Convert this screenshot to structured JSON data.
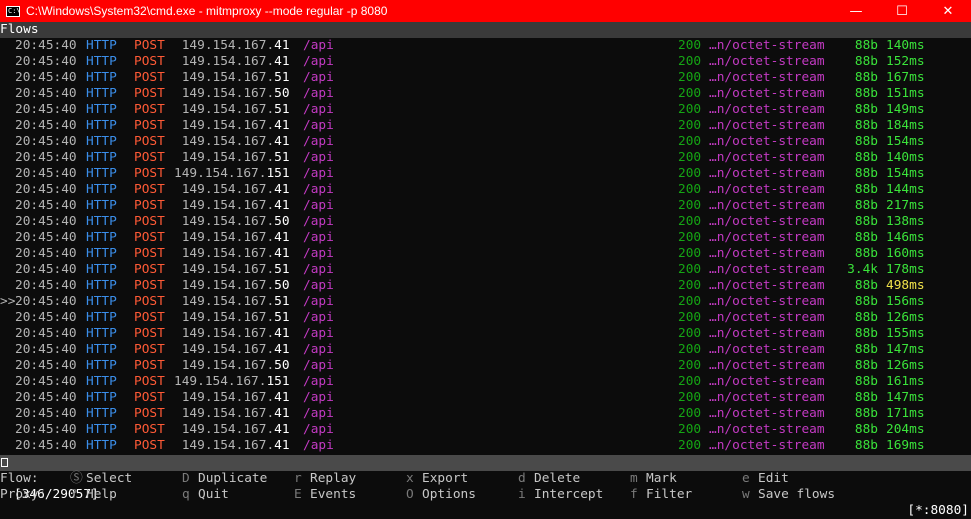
{
  "window": {
    "title": "C:\\Windows\\System32\\cmd.exe - mitmproxy  --mode regular -p 8080",
    "icon": "cmd-icon",
    "minimize_glyph": "—",
    "maximize_glyph": "☐",
    "close_glyph": "✕"
  },
  "header": {
    "label": "Flows"
  },
  "cursor_glyph": ">>",
  "flows": [
    {
      "time": "20:45:40",
      "scheme": "HTTP",
      "method": "POST",
      "host_prefix": " 149.154.167.",
      "host_last": "41",
      "path": "/api",
      "code": "200",
      "ctype": "…n/octet-stream",
      "size": "88b",
      "duration": "140ms"
    },
    {
      "time": "20:45:40",
      "scheme": "HTTP",
      "method": "POST",
      "host_prefix": " 149.154.167.",
      "host_last": "41",
      "path": "/api",
      "code": "200",
      "ctype": "…n/octet-stream",
      "size": "88b",
      "duration": "152ms"
    },
    {
      "time": "20:45:40",
      "scheme": "HTTP",
      "method": "POST",
      "host_prefix": " 149.154.167.",
      "host_last": "51",
      "path": "/api",
      "code": "200",
      "ctype": "…n/octet-stream",
      "size": "88b",
      "duration": "167ms"
    },
    {
      "time": "20:45:40",
      "scheme": "HTTP",
      "method": "POST",
      "host_prefix": " 149.154.167.",
      "host_last": "50",
      "path": "/api",
      "code": "200",
      "ctype": "…n/octet-stream",
      "size": "88b",
      "duration": "151ms"
    },
    {
      "time": "20:45:40",
      "scheme": "HTTP",
      "method": "POST",
      "host_prefix": " 149.154.167.",
      "host_last": "51",
      "path": "/api",
      "code": "200",
      "ctype": "…n/octet-stream",
      "size": "88b",
      "duration": "149ms"
    },
    {
      "time": "20:45:40",
      "scheme": "HTTP",
      "method": "POST",
      "host_prefix": " 149.154.167.",
      "host_last": "41",
      "path": "/api",
      "code": "200",
      "ctype": "…n/octet-stream",
      "size": "88b",
      "duration": "184ms"
    },
    {
      "time": "20:45:40",
      "scheme": "HTTP",
      "method": "POST",
      "host_prefix": " 149.154.167.",
      "host_last": "41",
      "path": "/api",
      "code": "200",
      "ctype": "…n/octet-stream",
      "size": "88b",
      "duration": "154ms"
    },
    {
      "time": "20:45:40",
      "scheme": "HTTP",
      "method": "POST",
      "host_prefix": " 149.154.167.",
      "host_last": "51",
      "path": "/api",
      "code": "200",
      "ctype": "…n/octet-stream",
      "size": "88b",
      "duration": "140ms"
    },
    {
      "time": "20:45:40",
      "scheme": "HTTP",
      "method": "POST",
      "host_prefix": "149.154.167.",
      "host_last": "151",
      "path": "/api",
      "code": "200",
      "ctype": "…n/octet-stream",
      "size": "88b",
      "duration": "154ms"
    },
    {
      "time": "20:45:40",
      "scheme": "HTTP",
      "method": "POST",
      "host_prefix": " 149.154.167.",
      "host_last": "41",
      "path": "/api",
      "code": "200",
      "ctype": "…n/octet-stream",
      "size": "88b",
      "duration": "144ms"
    },
    {
      "time": "20:45:40",
      "scheme": "HTTP",
      "method": "POST",
      "host_prefix": " 149.154.167.",
      "host_last": "41",
      "path": "/api",
      "code": "200",
      "ctype": "…n/octet-stream",
      "size": "88b",
      "duration": "217ms"
    },
    {
      "time": "20:45:40",
      "scheme": "HTTP",
      "method": "POST",
      "host_prefix": " 149.154.167.",
      "host_last": "50",
      "path": "/api",
      "code": "200",
      "ctype": "…n/octet-stream",
      "size": "88b",
      "duration": "138ms"
    },
    {
      "time": "20:45:40",
      "scheme": "HTTP",
      "method": "POST",
      "host_prefix": " 149.154.167.",
      "host_last": "41",
      "path": "/api",
      "code": "200",
      "ctype": "…n/octet-stream",
      "size": "88b",
      "duration": "146ms"
    },
    {
      "time": "20:45:40",
      "scheme": "HTTP",
      "method": "POST",
      "host_prefix": " 149.154.167.",
      "host_last": "41",
      "path": "/api",
      "code": "200",
      "ctype": "…n/octet-stream",
      "size": "88b",
      "duration": "160ms"
    },
    {
      "time": "20:45:40",
      "scheme": "HTTP",
      "method": "POST",
      "host_prefix": " 149.154.167.",
      "host_last": "51",
      "path": "/api",
      "code": "200",
      "ctype": "…n/octet-stream",
      "size": "3.4k",
      "duration": "178ms"
    },
    {
      "time": "20:45:40",
      "scheme": "HTTP",
      "method": "POST",
      "host_prefix": " 149.154.167.",
      "host_last": "50",
      "path": "/api",
      "code": "200",
      "ctype": "…n/octet-stream",
      "size": "88b",
      "duration": "498ms",
      "warn": true
    },
    {
      "time": "20:45:40",
      "scheme": "HTTP",
      "method": "POST",
      "host_prefix": " 149.154.167.",
      "host_last": "51",
      "path": "/api",
      "code": "200",
      "ctype": "…n/octet-stream",
      "size": "88b",
      "duration": "156ms",
      "selected": true
    },
    {
      "time": "20:45:40",
      "scheme": "HTTP",
      "method": "POST",
      "host_prefix": " 149.154.167.",
      "host_last": "51",
      "path": "/api",
      "code": "200",
      "ctype": "…n/octet-stream",
      "size": "88b",
      "duration": "126ms"
    },
    {
      "time": "20:45:40",
      "scheme": "HTTP",
      "method": "POST",
      "host_prefix": " 149.154.167.",
      "host_last": "41",
      "path": "/api",
      "code": "200",
      "ctype": "…n/octet-stream",
      "size": "88b",
      "duration": "155ms"
    },
    {
      "time": "20:45:40",
      "scheme": "HTTP",
      "method": "POST",
      "host_prefix": " 149.154.167.",
      "host_last": "41",
      "path": "/api",
      "code": "200",
      "ctype": "…n/octet-stream",
      "size": "88b",
      "duration": "147ms"
    },
    {
      "time": "20:45:40",
      "scheme": "HTTP",
      "method": "POST",
      "host_prefix": " 149.154.167.",
      "host_last": "50",
      "path": "/api",
      "code": "200",
      "ctype": "…n/octet-stream",
      "size": "88b",
      "duration": "126ms"
    },
    {
      "time": "20:45:40",
      "scheme": "HTTP",
      "method": "POST",
      "host_prefix": "149.154.167.",
      "host_last": "151",
      "path": "/api",
      "code": "200",
      "ctype": "…n/octet-stream",
      "size": "88b",
      "duration": "161ms"
    },
    {
      "time": "20:45:40",
      "scheme": "HTTP",
      "method": "POST",
      "host_prefix": " 149.154.167.",
      "host_last": "41",
      "path": "/api",
      "code": "200",
      "ctype": "…n/octet-stream",
      "size": "88b",
      "duration": "147ms"
    },
    {
      "time": "20:45:40",
      "scheme": "HTTP",
      "method": "POST",
      "host_prefix": " 149.154.167.",
      "host_last": "41",
      "path": "/api",
      "code": "200",
      "ctype": "…n/octet-stream",
      "size": "88b",
      "duration": "171ms"
    },
    {
      "time": "20:45:40",
      "scheme": "HTTP",
      "method": "POST",
      "host_prefix": " 149.154.167.",
      "host_last": "41",
      "path": "/api",
      "code": "200",
      "ctype": "…n/octet-stream",
      "size": "88b",
      "duration": "204ms"
    },
    {
      "time": "20:45:40",
      "scheme": "HTTP",
      "method": "POST",
      "host_prefix": " 149.154.167.",
      "host_last": "41",
      "path": "/api",
      "code": "200",
      "ctype": "…n/octet-stream",
      "size": "88b",
      "duration": "169ms"
    }
  ],
  "status": {
    "count": "[346/29057]",
    "mode": "[*:8080]"
  },
  "keybindings": [
    {
      "prefix": "Flow:",
      "items": [
        {
          "key": "Ⓢ",
          "label": "Select"
        },
        {
          "key": "D",
          "label": "Duplicate"
        },
        {
          "key": "r",
          "label": "Replay"
        },
        {
          "key": "x",
          "label": "Export"
        },
        {
          "key": "d",
          "label": "Delete"
        },
        {
          "key": "m",
          "label": "Mark"
        },
        {
          "key": "e",
          "label": "Edit"
        }
      ]
    },
    {
      "prefix": "Proxy:",
      "items": [
        {
          "key": "?",
          "label": "Help"
        },
        {
          "key": "q",
          "label": "Quit"
        },
        {
          "key": "E",
          "label": "Events"
        },
        {
          "key": "O",
          "label": "Options"
        },
        {
          "key": "i",
          "label": "Intercept"
        },
        {
          "key": "f",
          "label": "Filter"
        },
        {
          "key": "w",
          "label": "Save flows"
        }
      ]
    }
  ],
  "colors": {
    "titlebar": "#ff0000",
    "scheme": "#3b8eea",
    "method": "#ff5a36",
    "path": "#c33ac3",
    "code": "#15a514",
    "size": "#3ae33a",
    "slow": "#f0e24a"
  }
}
